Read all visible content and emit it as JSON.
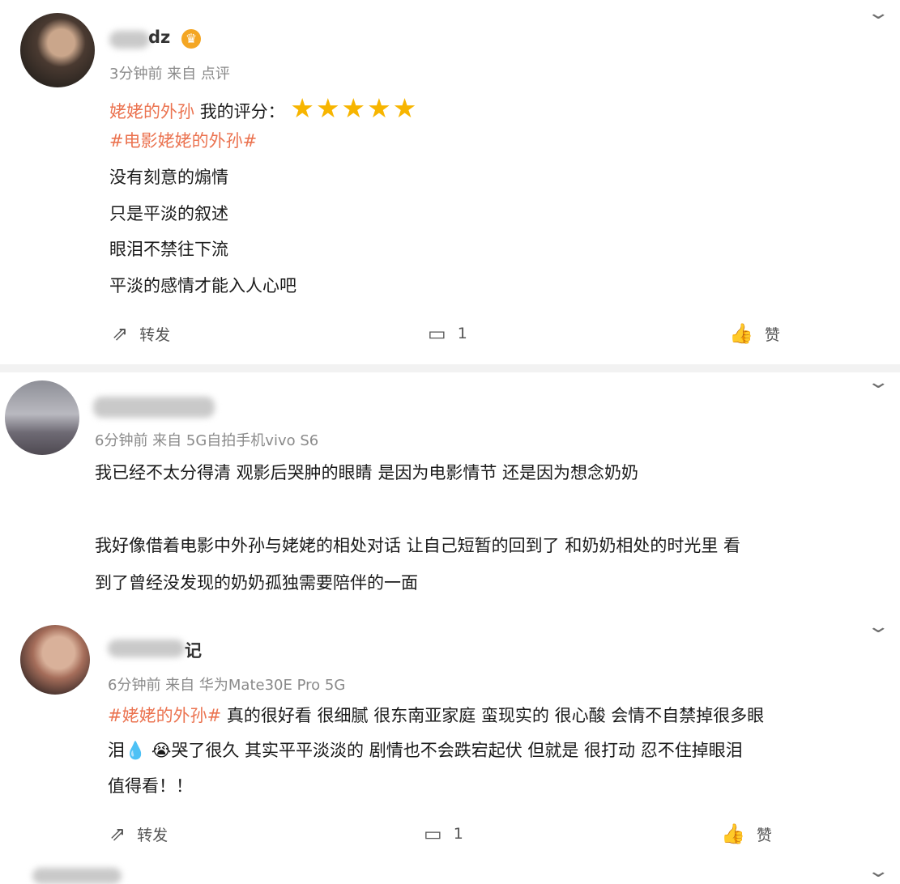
{
  "posts": [
    {
      "name_suffix": "dz",
      "meta": "3分钟前  来自 点评",
      "review_title": "姥姥的外孙",
      "rating_label": "我的评分：",
      "rating": 5,
      "hashtag": "#电影姥姥的外孙#",
      "lines": [
        "没有刻意的煽情",
        "只是平淡的叙述",
        "眼泪不禁往下流",
        "平淡的感情才能入人心吧"
      ],
      "repost_label": "转发",
      "comment_count": "1",
      "like_label": "赞"
    },
    {
      "meta": "6分钟前  来自 5G自拍手机vivo S6",
      "lines": [
        "我已经不太分得清 观影后哭肿的眼睛 是因为电影情节 还是因为想念奶奶",
        "我好像借着电影中外孙与姥姥的相处对话 让自己短暂的回到了 和奶奶相处的时光里 看",
        "到了曾经没发现的奶奶孤独需要陪伴的一面"
      ]
    },
    {
      "name_suffix": "记",
      "meta": "6分钟前  来自 华为Mate30E Pro 5G",
      "hashtag": "#姥姥的外孙#",
      "line1_rest": " 真的很好看 很细腻 很东南亚家庭 蛮现实的 很心酸 会情不自禁掉很多眼",
      "line2": "泪💧 😭哭了很久 其实平平淡淡的 剧情也不会跌宕起伏 但就是 很打动 忍不住掉眼泪",
      "line3": "值得看！！",
      "repost_label": "转发",
      "comment_count": "1",
      "like_label": "赞"
    }
  ],
  "icons": {
    "chevron": "⌄",
    "repost": "⇗",
    "comment": "▭",
    "like": "👍",
    "crown": "♛"
  },
  "accent": "#eb7350",
  "star_color": "#f7b500"
}
